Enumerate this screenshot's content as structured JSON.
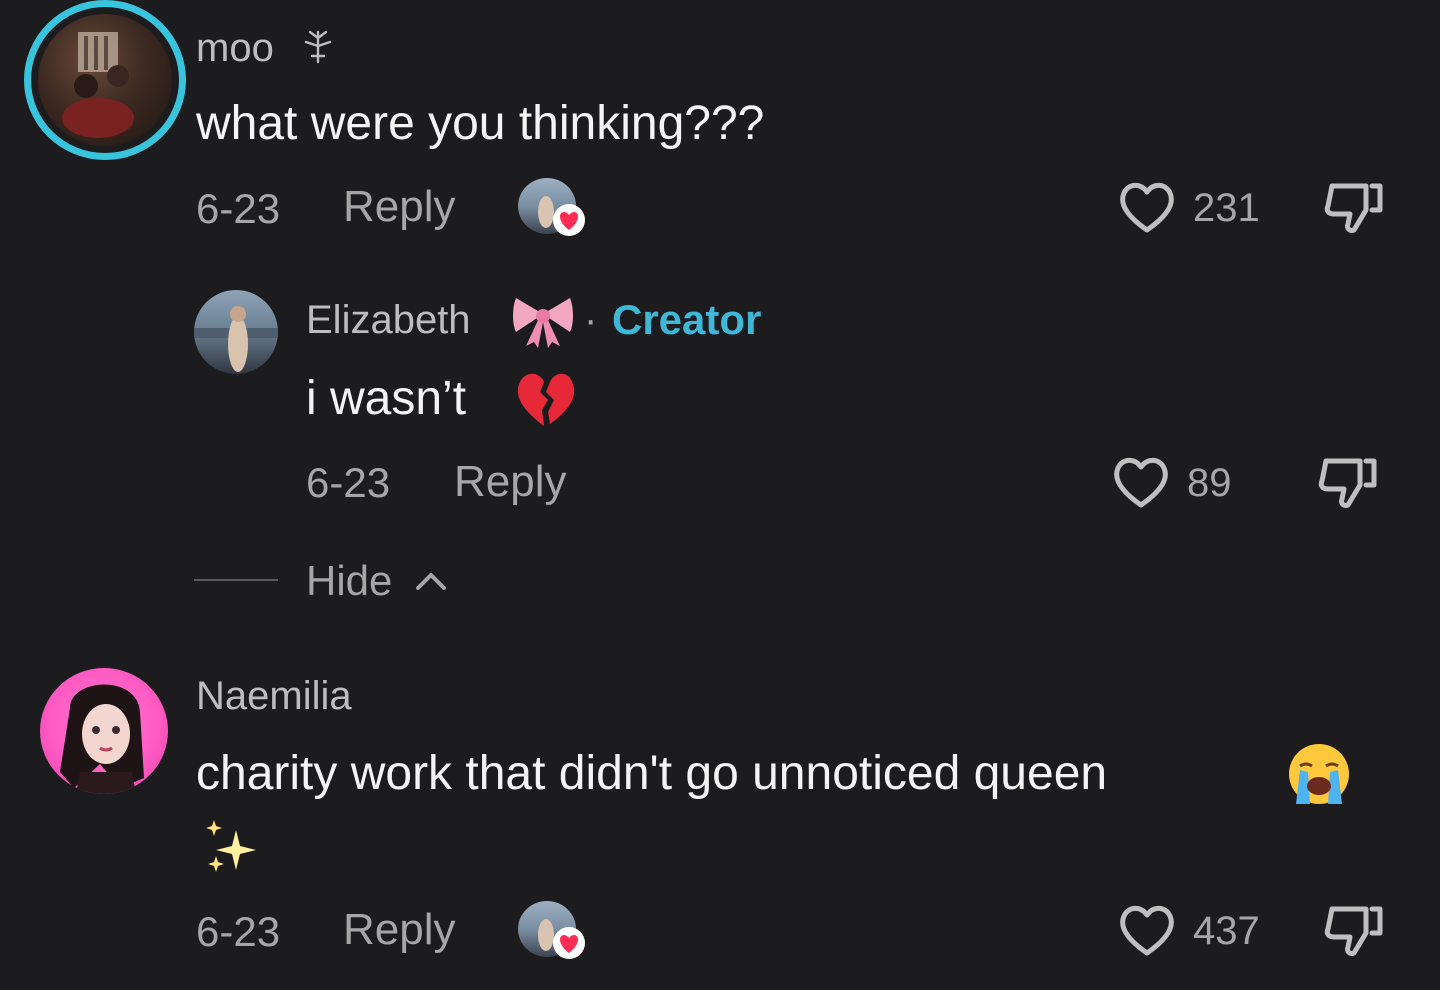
{
  "comments": [
    {
      "username": "moo",
      "text": "what were you thinking???",
      "date": "6-23",
      "reply_label": "Reply",
      "likes": "231"
    },
    {
      "username": "Elizabeth",
      "badge": "Creator",
      "text": "i wasn’t",
      "date": "6-23",
      "reply_label": "Reply",
      "likes": "89"
    },
    {
      "username": "Naemilia",
      "text_line1": "charity work that didn't go unnoticed queen",
      "date": "6-23",
      "reply_label": "Reply",
      "likes": "437"
    }
  ],
  "hide_label": "Hide",
  "colors": {
    "background": "#1c1c1e",
    "creator_accent": "#3fb7d6",
    "story_ring": "#39c4dd",
    "heart_badge": "#ff2d55"
  }
}
